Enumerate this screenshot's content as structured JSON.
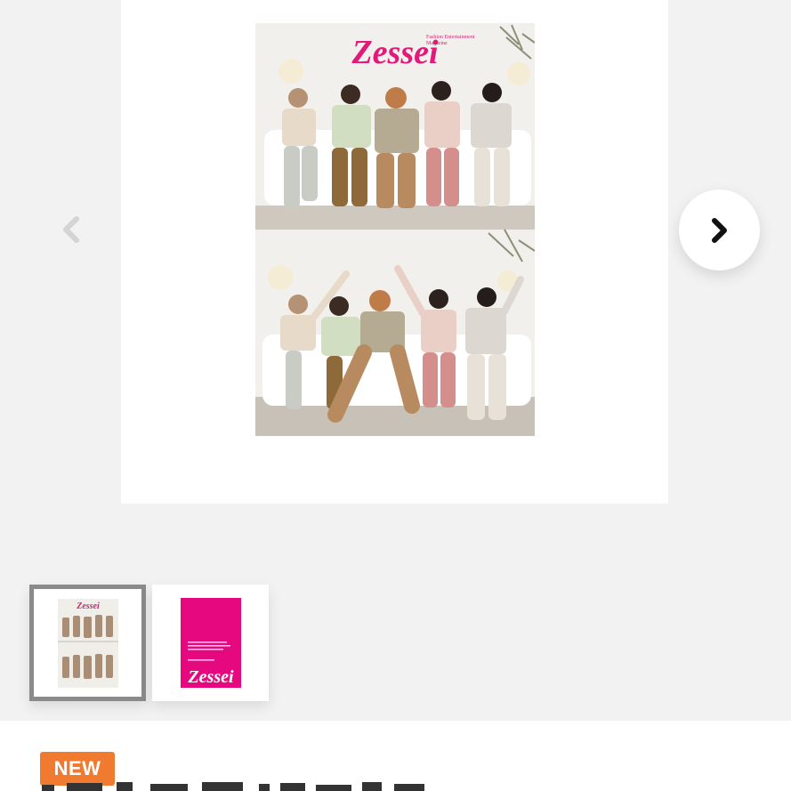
{
  "gallery": {
    "main_image": {
      "magazine_name": "Zessei",
      "magazine_tagline": "Fashion Entertainment Magazine",
      "accent_color": "#e3197a",
      "alt": "Zessei magazine cover with two group photos"
    },
    "prev_icon": "chevron-left-icon",
    "next_icon": "chevron-right-icon",
    "thumbnails": [
      {
        "name": "Zessei",
        "selected": true
      },
      {
        "name": "Zessei",
        "selected": false,
        "cover_color": "#e5087f"
      }
    ]
  },
  "product": {
    "badge": "NEW"
  }
}
